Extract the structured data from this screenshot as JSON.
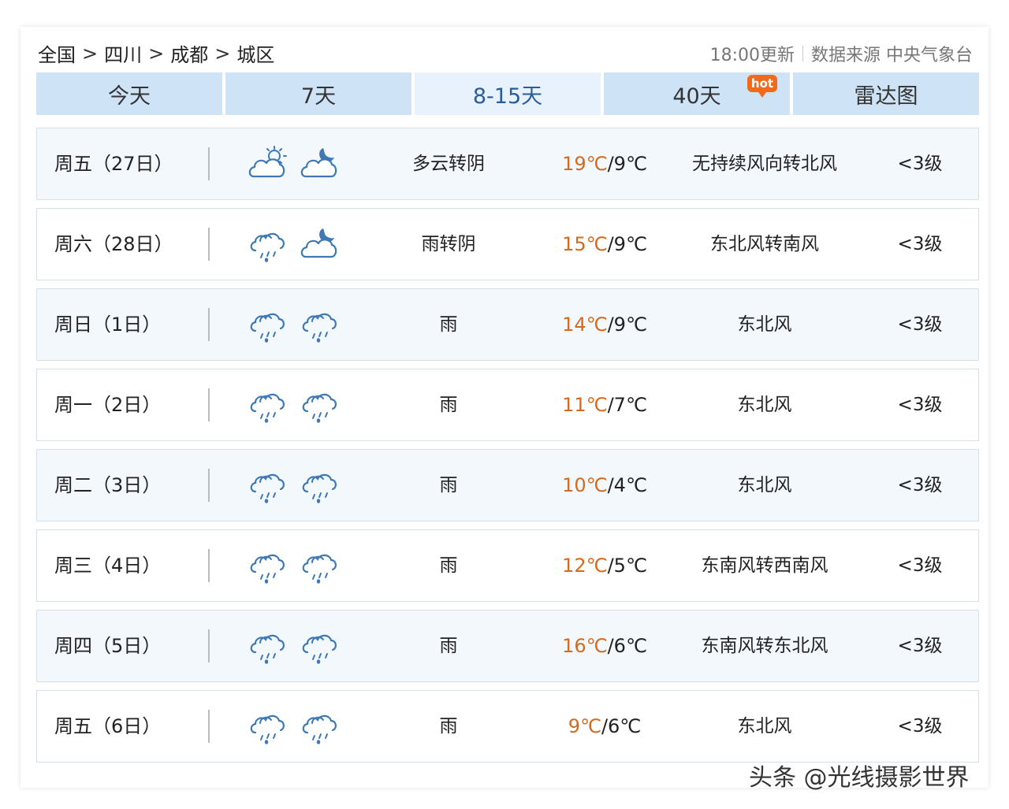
{
  "breadcrumb": [
    "全国",
    "四川",
    "成都",
    "城区"
  ],
  "breadcrumb_separator": ">",
  "update_time": "18:00更新",
  "data_source": "数据来源 中央气象台",
  "tabs": [
    {
      "label": "今天",
      "active": false
    },
    {
      "label": "7天",
      "active": false
    },
    {
      "label": "8-15天",
      "active": true
    },
    {
      "label": "40天",
      "active": false,
      "badge": "hot"
    },
    {
      "label": "雷达图",
      "active": false
    }
  ],
  "colors": {
    "high_temp": "#d6691e",
    "tab_bg": "#cfe3f7",
    "tab_active_text": "#2b5c9a",
    "icon_stroke": "#3f79b5",
    "hot_badge": "#f06a1e"
  },
  "forecast": [
    {
      "day": "周五（27日）",
      "icons": [
        "partly-cloudy-day-icon",
        "cloudy-night-icon"
      ],
      "condition": "多云转阴",
      "high": "19℃",
      "low": "/9℃",
      "wind": "无持续风向转北风",
      "level": "<3级"
    },
    {
      "day": "周六（28日）",
      "icons": [
        "rain-icon",
        "cloudy-night-icon"
      ],
      "condition": "雨转阴",
      "high": "15℃",
      "low": "/9℃",
      "wind": "东北风转南风",
      "level": "<3级"
    },
    {
      "day": "周日（1日）",
      "icons": [
        "rain-icon",
        "rain-icon"
      ],
      "condition": "雨",
      "high": "14℃",
      "low": "/9℃",
      "wind": "东北风",
      "level": "<3级"
    },
    {
      "day": "周一（2日）",
      "icons": [
        "rain-icon",
        "rain-icon"
      ],
      "condition": "雨",
      "high": "11℃",
      "low": "/7℃",
      "wind": "东北风",
      "level": "<3级"
    },
    {
      "day": "周二（3日）",
      "icons": [
        "rain-icon",
        "rain-icon"
      ],
      "condition": "雨",
      "high": "10℃",
      "low": "/4℃",
      "wind": "东北风",
      "level": "<3级"
    },
    {
      "day": "周三（4日）",
      "icons": [
        "rain-icon",
        "rain-icon"
      ],
      "condition": "雨",
      "high": "12℃",
      "low": "/5℃",
      "wind": "东南风转西南风",
      "level": "<3级"
    },
    {
      "day": "周四（5日）",
      "icons": [
        "rain-icon",
        "rain-icon"
      ],
      "condition": "雨",
      "high": "16℃",
      "low": "/6℃",
      "wind": "东南风转东北风",
      "level": "<3级"
    },
    {
      "day": "周五（6日）",
      "icons": [
        "rain-icon",
        "rain-icon"
      ],
      "condition": "雨",
      "high": "9℃",
      "low": "/6℃",
      "wind": "东北风",
      "level": "<3级"
    }
  ],
  "watermark": "头条 @光线摄影世界"
}
